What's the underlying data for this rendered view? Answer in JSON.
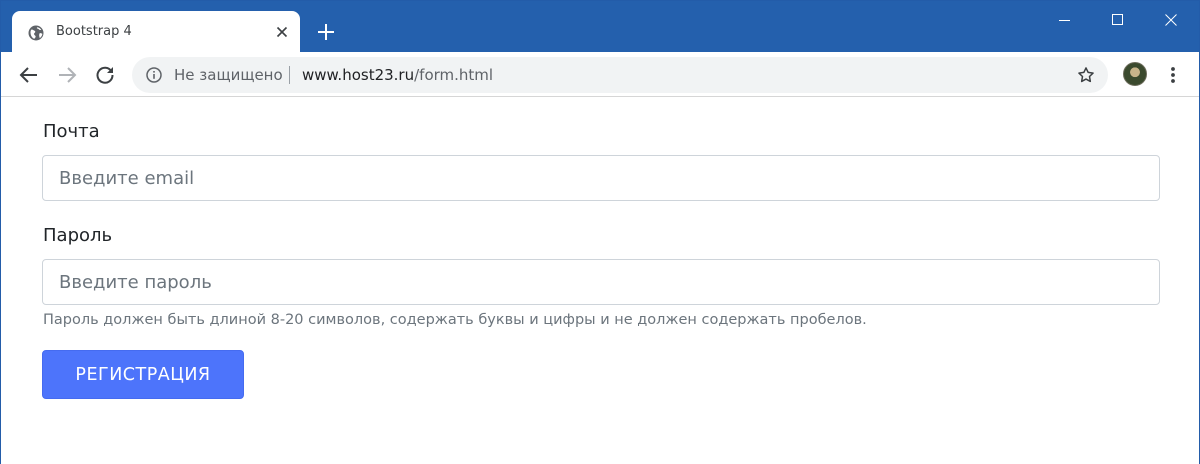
{
  "tab": {
    "title": "Bootstrap 4"
  },
  "toolbar": {
    "security_text": "Не защищено",
    "url_host": "www.host23.ru",
    "url_path": "/form.html"
  },
  "icons": {
    "globe": "globe-icon",
    "close": "close-icon",
    "new_tab": "plus-icon",
    "minimize": "minimize-icon",
    "maximize": "maximize-icon",
    "window_close": "close-icon",
    "back": "arrow-left-icon",
    "forward": "arrow-right-icon",
    "reload": "reload-icon",
    "info": "info-icon",
    "bookmark": "star-icon",
    "menu": "kebab-menu-icon"
  },
  "form": {
    "email_label": "Почта",
    "email_placeholder": "Введите email",
    "email_value": "",
    "password_label": "Пароль",
    "password_placeholder": "Введите пароль",
    "password_value": "",
    "password_help": "Пароль должен быть длиной 8-20 символов, содержать буквы и цифры и не должен содержать пробелов.",
    "submit_label": "РЕГИСТРАЦИЯ"
  },
  "colors": {
    "titlebar": "#2460ad",
    "primary_button": "#4d74fb",
    "input_border": "#ced4da",
    "help_text": "#6c757d"
  }
}
